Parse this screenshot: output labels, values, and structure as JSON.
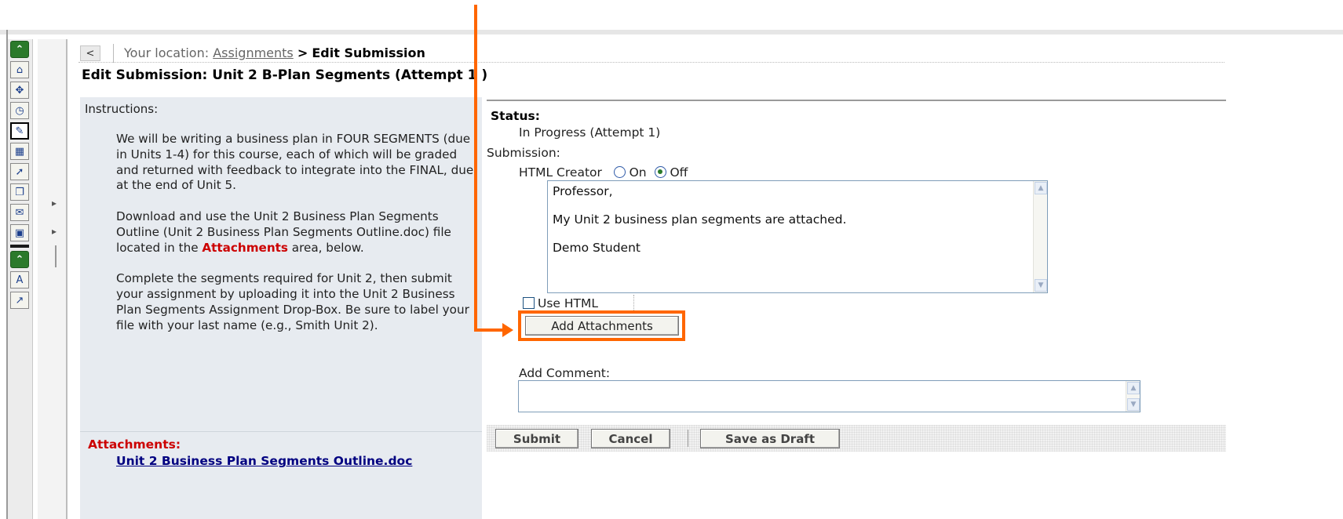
{
  "colors": {
    "highlight": "#ff6600",
    "panel_bg": "#e7ebf0",
    "attachment_red": "#cc0000",
    "link_navy": "#000080",
    "toolbar_green": "#2b7a2b"
  },
  "toolbar": {
    "icons": [
      "collapse-up-icon",
      "home-icon",
      "satellite-icon",
      "calendar-clock-icon",
      "edit-assignment-icon",
      "grid-icon",
      "pin-icon",
      "documents-icon",
      "add-mail-icon",
      "gradebook-icon",
      "collapse-up-icon",
      "letter-a-icon",
      "chart-icon"
    ],
    "selected_index": 4
  },
  "location": {
    "back_label": "<",
    "prefix": "Your location:",
    "link": "Assignments",
    "separator": ">",
    "current": "Edit Submission"
  },
  "page_title": "Edit Submission: Unit 2 B-Plan Segments (Attempt 1 )",
  "instructions": {
    "heading": "Instructions:",
    "p1": "We will be writing a business plan in FOUR SEGMENTS (due in Units 1-4) for this course, each of which will be graded and returned with feedback to integrate into the FINAL, due at the end of Unit 5.",
    "p2_before": "Download and use the Unit 2 Business Plan Segments Outline (Unit 2 Business Plan Segments Outline.doc) file located in the ",
    "p2_highlight": "Attachments",
    "p2_after": " area, below.",
    "p3": "Complete the segments required for Unit 2, then submit your assignment by uploading it into the Unit 2 Business Plan Segments Assignment Drop-Box. Be sure to label your file with your last name (e.g., Smith Unit 2).",
    "attachments_label": "Attachments:",
    "attachment_link": "Unit 2 Business Plan Segments Outline.doc"
  },
  "submission": {
    "status_label": "Status:",
    "status_value": "In Progress (Attempt 1)",
    "submission_label": "Submission:",
    "html_creator_label": "HTML Creator",
    "on_label": "On",
    "off_label": "Off",
    "html_creator_selected": "Off",
    "text_value": "Professor,\n\nMy Unit 2 business plan segments are attached.\n\nDemo Student",
    "use_html_label": "Use HTML",
    "use_html_checked": false,
    "add_attachments_label": "Add Attachments",
    "add_comment_label": "Add Comment:",
    "comment_value": ""
  },
  "actions": {
    "submit": "Submit",
    "cancel": "Cancel",
    "save_draft": "Save as Draft"
  }
}
